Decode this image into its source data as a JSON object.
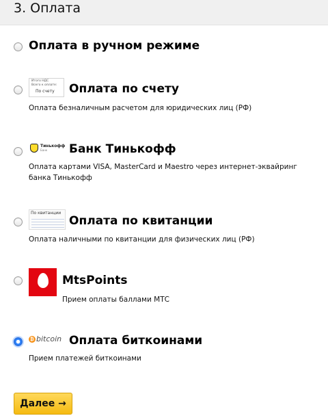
{
  "section": {
    "title": "3. Оплата"
  },
  "options": [
    {
      "title": "Оплата в ручном режиме",
      "description": "",
      "selected": false
    },
    {
      "title": "Оплата по счету",
      "description": "Оплата безналичным расчетом для юридических лиц (РФ)",
      "selected": false,
      "logo": {
        "icon": "invoice-logo",
        "line1": "Итого НДС",
        "line2": "Всего к оплате:",
        "line3": "По счету"
      }
    },
    {
      "title": "Банк Тинькофф",
      "description": "Оплата картами VISA, MasterCard и Maestro через интернет-эквайринг банка Тинькофф",
      "selected": false,
      "logo": {
        "icon": "tinkoff-logo",
        "name": "Тинькофф",
        "sub": "Банк",
        "color": "#ffdd2d"
      }
    },
    {
      "title": "Оплата по квитанции",
      "description": "Оплата наличными по квитанции для физических лиц (РФ)",
      "selected": false,
      "logo": {
        "icon": "receipt-logo",
        "text": "По квитанции"
      }
    },
    {
      "title": "MtsPoints",
      "description": "Прием оплаты баллами МТС",
      "selected": false,
      "logo": {
        "icon": "mts-egg-logo",
        "color": "#e30611"
      }
    },
    {
      "title": "Оплата биткоинами",
      "description": "Прием платежей биткоинами",
      "selected": true,
      "logo": {
        "icon": "bitcoin-logo",
        "symbol": "₿",
        "word": "bitcoin",
        "color": "#f7931a"
      }
    }
  ],
  "next_button": {
    "label": "Далее →",
    "color": "#f5bb12"
  }
}
